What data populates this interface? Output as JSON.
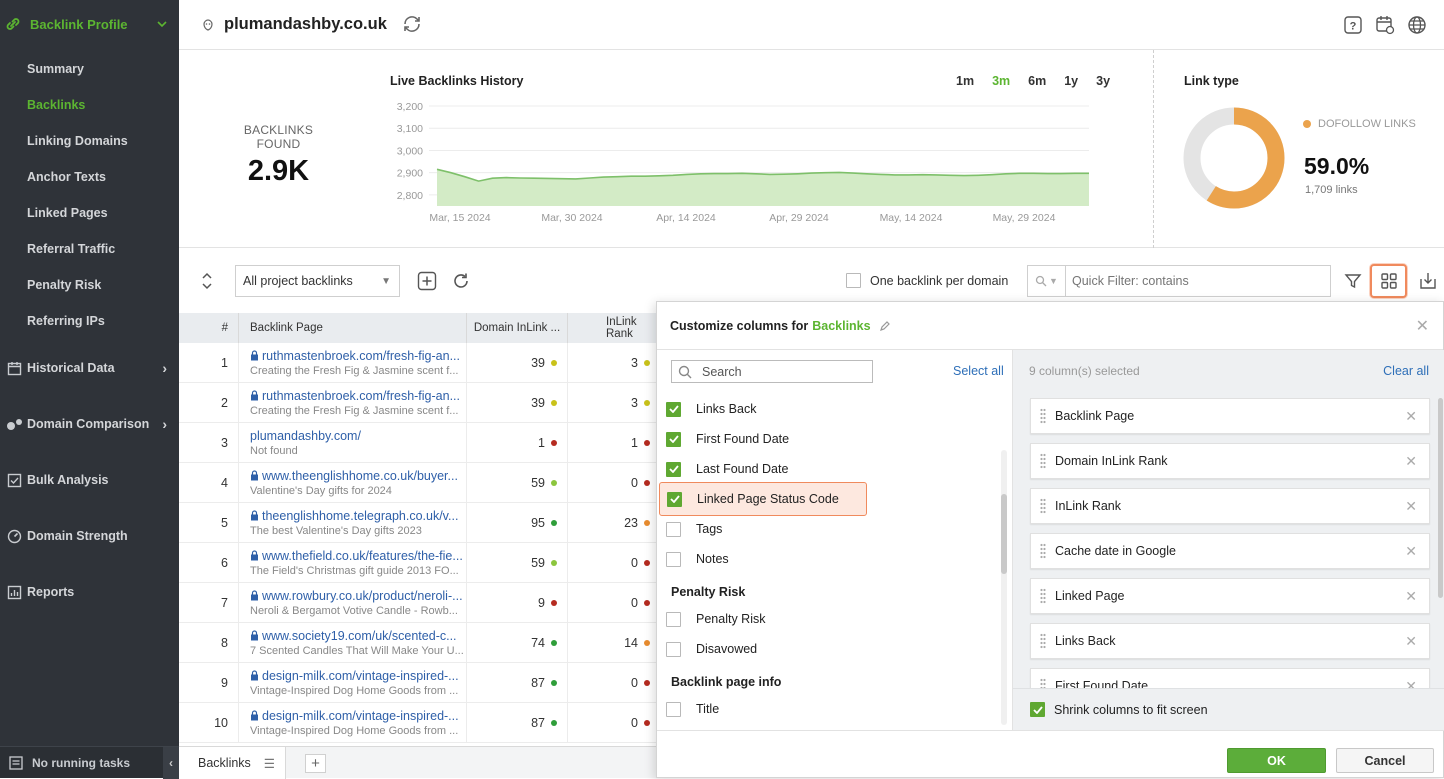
{
  "sidebar": {
    "header": "Backlink Profile",
    "sub_items": [
      {
        "label": "Summary",
        "active": false
      },
      {
        "label": "Backlinks",
        "active": true
      },
      {
        "label": "Linking Domains",
        "active": false
      },
      {
        "label": "Anchor Texts",
        "active": false
      },
      {
        "label": "Linked Pages",
        "active": false
      },
      {
        "label": "Referral Traffic",
        "active": false
      },
      {
        "label": "Penalty Risk",
        "active": false
      },
      {
        "label": "Referring IPs",
        "active": false
      }
    ],
    "groups": [
      {
        "label": "Historical Data",
        "icon": "calendar-icon",
        "arrow": true
      },
      {
        "label": "Domain Comparison",
        "icon": "compare-icon",
        "arrow": true
      },
      {
        "label": "Bulk Analysis",
        "icon": "checklist-icon",
        "arrow": false
      },
      {
        "label": "Domain Strength",
        "icon": "gauge-icon",
        "arrow": false
      },
      {
        "label": "Reports",
        "icon": "report-icon",
        "arrow": false
      }
    ],
    "footer": "No running tasks",
    "accent": "#5cb531"
  },
  "header": {
    "domain": "plumandashby.co.uk"
  },
  "stats": {
    "backlinks_label": "BACKLINKS FOUND",
    "backlinks_value": "2.9K",
    "chart_title": "Live Backlinks History",
    "periods": [
      {
        "label": "1m",
        "active": false
      },
      {
        "label": "3m",
        "active": true
      },
      {
        "label": "6m",
        "active": false
      },
      {
        "label": "1y",
        "active": false
      },
      {
        "label": "3y",
        "active": false
      }
    ],
    "link_type_title": "Link type",
    "dofollow_label": "DOFOLLOW LINKS",
    "dofollow_pct": "59.0%",
    "dofollow_count": "1,709 links",
    "dofollow_fraction": 0.59
  },
  "chart_data": {
    "type": "area",
    "title": "Live Backlinks History",
    "xlabel": "",
    "ylabel": "",
    "ylim": [
      2750,
      3200
    ],
    "y_ticks": [
      "3,200",
      "3,100",
      "3,000",
      "2,900",
      "2,800"
    ],
    "x_ticks": [
      "Mar, 15 2024",
      "Mar, 30 2024",
      "Apr, 14 2024",
      "Apr, 29 2024",
      "May, 14 2024",
      "May, 29 2024"
    ],
    "series": [
      {
        "values": [
          2915,
          2900,
          2882,
          2862,
          2875,
          2878,
          2876,
          2875,
          2874,
          2873,
          2872,
          2876,
          2880,
          2882,
          2884,
          2884,
          2886,
          2888,
          2892,
          2895,
          2896,
          2896,
          2897,
          2895,
          2892,
          2893,
          2895,
          2898,
          2900,
          2901,
          2898,
          2895,
          2892,
          2890,
          2890,
          2891,
          2890,
          2888,
          2887,
          2888,
          2891,
          2895,
          2897,
          2897,
          2896,
          2896,
          2897,
          2897
        ]
      }
    ],
    "colors": {
      "line": "#7ec06a",
      "fill": "#d3ebc6"
    }
  },
  "toolbar": {
    "select_value": "All project backlinks",
    "one_per_domain": "One backlink per domain",
    "quick_filter_placeholder": "Quick Filter: contains"
  },
  "table": {
    "headers": {
      "num": "#",
      "page": "Backlink Page",
      "domain_rank": "Domain InLink ...",
      "inlink_rank": "InLink Rank"
    },
    "rows": [
      {
        "n": "1",
        "url": "ruthmastenbroek.com/fresh-fig-an...",
        "title": "Creating the Fresh Fig & Jasmine scent f...",
        "secure": true,
        "dr": "39",
        "dr_color": "#c9c21a",
        "ir": "3",
        "ir_color": "#c9c21a"
      },
      {
        "n": "2",
        "url": "ruthmastenbroek.com/fresh-fig-an...",
        "title": "Creating the Fresh Fig & Jasmine scent f...",
        "secure": true,
        "dr": "39",
        "dr_color": "#c9c21a",
        "ir": "3",
        "ir_color": "#c9c21a"
      },
      {
        "n": "3",
        "url": "plumandashby.com/",
        "title": "Not found",
        "secure": false,
        "dr": "1",
        "dr_color": "#b52b20",
        "ir": "1",
        "ir_color": "#b52b20"
      },
      {
        "n": "4",
        "url": "www.theenglishhome.co.uk/buyer...",
        "title": "Valentine's Day gifts for 2024",
        "secure": true,
        "dr": "59",
        "dr_color": "#8cc63e",
        "ir": "0",
        "ir_color": "#b52b20"
      },
      {
        "n": "5",
        "url": "theenglishhome.telegraph.co.uk/v...",
        "title": "The best Valentine's Day gifts 2023",
        "secure": true,
        "dr": "95",
        "dr_color": "#2f9e3a",
        "ir": "23",
        "ir_color": "#e88c2f"
      },
      {
        "n": "6",
        "url": "www.thefield.co.uk/features/the-fie...",
        "title": "The Field's Christmas gift guide 2013 FO...",
        "secure": true,
        "dr": "59",
        "dr_color": "#8cc63e",
        "ir": "0",
        "ir_color": "#b52b20"
      },
      {
        "n": "7",
        "url": "www.rowbury.co.uk/product/neroli-...",
        "title": "Neroli & Bergamot Votive Candle - Rowb...",
        "secure": true,
        "dr": "9",
        "dr_color": "#b52b20",
        "ir": "0",
        "ir_color": "#b52b20"
      },
      {
        "n": "8",
        "url": "www.society19.com/uk/scented-c...",
        "title": "7 Scented Candles That Will Make Your U...",
        "secure": true,
        "dr": "74",
        "dr_color": "#2f9e3a",
        "ir": "14",
        "ir_color": "#e88c2f"
      },
      {
        "n": "9",
        "url": "design-milk.com/vintage-inspired-...",
        "title": "Vintage-Inspired Dog Home Goods from ...",
        "secure": true,
        "dr": "87",
        "dr_color": "#2f9e3a",
        "ir": "0",
        "ir_color": "#b52b20"
      },
      {
        "n": "10",
        "url": "design-milk.com/vintage-inspired-...",
        "title": "Vintage-Inspired Dog Home Goods from ...",
        "secure": true,
        "dr": "87",
        "dr_color": "#2f9e3a",
        "ir": "0",
        "ir_color": "#b52b20"
      }
    ]
  },
  "tabs": {
    "active": "Backlinks"
  },
  "panel": {
    "title_prefix": "Customize columns for",
    "title_target": "Backlinks",
    "search_placeholder": "Search",
    "select_all": "Select all",
    "options": [
      {
        "label": "Links Back",
        "checked": true
      },
      {
        "label": "First Found Date",
        "checked": true
      },
      {
        "label": "Last Found Date",
        "checked": true
      },
      {
        "label": "Linked Page Status Code",
        "checked": true,
        "highlighted": true
      },
      {
        "label": "Tags",
        "checked": false
      },
      {
        "label": "Notes",
        "checked": false
      }
    ],
    "section_penalty": "Penalty Risk",
    "penalty_options": [
      {
        "label": "Penalty Risk",
        "checked": false
      },
      {
        "label": "Disavowed",
        "checked": false
      }
    ],
    "section_page_info": "Backlink page info",
    "page_info_options": [
      {
        "label": "Title",
        "checked": false
      }
    ],
    "selected_count": "9 column(s) selected",
    "clear_all": "Clear all",
    "selected_columns": [
      "Backlink Page",
      "Domain InLink Rank",
      "InLink Rank",
      "Cache date in Google",
      "Linked Page",
      "Links Back",
      "First Found Date"
    ],
    "shrink_label": "Shrink columns to fit screen",
    "ok": "OK",
    "cancel": "Cancel"
  }
}
